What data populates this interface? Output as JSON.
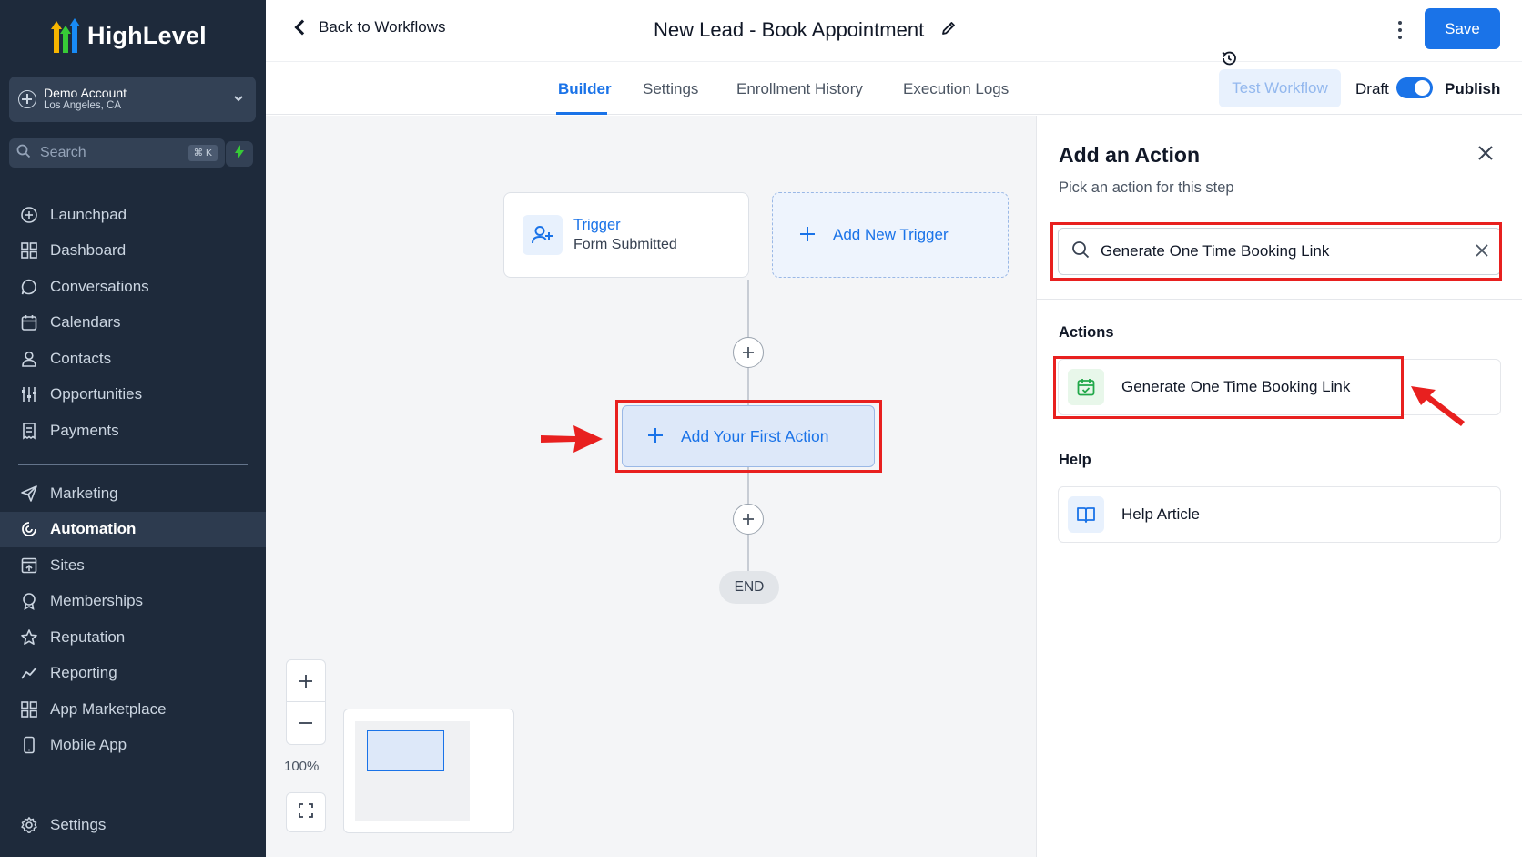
{
  "brand": {
    "name": "HighLevel",
    "accent": "#1a73e8",
    "highlight": "#e8201f"
  },
  "account": {
    "name": "Demo Account",
    "location": "Los Angeles, CA"
  },
  "sidebar_search": {
    "placeholder": "Search",
    "shortcut": "⌘ K"
  },
  "nav": {
    "group1": [
      {
        "label": "Launchpad",
        "icon": "launchpad-icon"
      },
      {
        "label": "Dashboard",
        "icon": "dashboard-icon"
      },
      {
        "label": "Conversations",
        "icon": "chat-icon"
      },
      {
        "label": "Calendars",
        "icon": "calendar-icon"
      },
      {
        "label": "Contacts",
        "icon": "contacts-icon"
      },
      {
        "label": "Opportunities",
        "icon": "opportunities-icon"
      },
      {
        "label": "Payments",
        "icon": "payments-icon"
      }
    ],
    "group2": [
      {
        "label": "Marketing",
        "icon": "send-icon"
      },
      {
        "label": "Automation",
        "icon": "automation-icon",
        "active": true
      },
      {
        "label": "Sites",
        "icon": "sites-icon"
      },
      {
        "label": "Memberships",
        "icon": "memberships-icon"
      },
      {
        "label": "Reputation",
        "icon": "star-icon"
      },
      {
        "label": "Reporting",
        "icon": "reporting-icon"
      },
      {
        "label": "App Marketplace",
        "icon": "marketplace-icon"
      },
      {
        "label": "Mobile App",
        "icon": "mobile-icon"
      }
    ],
    "settings": {
      "label": "Settings",
      "icon": "gear-icon"
    }
  },
  "header": {
    "back_label": "Back to Workflows",
    "workflow_title": "New Lead - Book Appointment",
    "save_label": "Save"
  },
  "tabs": [
    {
      "label": "Builder",
      "active": true
    },
    {
      "label": "Settings"
    },
    {
      "label": "Enrollment History"
    },
    {
      "label": "Execution Logs"
    }
  ],
  "workflow_controls": {
    "test_label": "Test Workflow",
    "draft_label": "Draft",
    "publish_label": "Publish",
    "published": true
  },
  "canvas": {
    "trigger": {
      "title": "Trigger",
      "subtitle": "Form Submitted"
    },
    "add_trigger_label": "Add New Trigger",
    "first_action_label": "Add Your First Action",
    "end_label": "END",
    "zoom_level": "100%"
  },
  "panel": {
    "title": "Add an Action",
    "subtitle": "Pick an action for this step",
    "search_value": "Generate One Time Booking Link",
    "actions_heading": "Actions",
    "action_item": "Generate One Time Booking Link",
    "help_heading": "Help",
    "help_item": "Help Article"
  }
}
